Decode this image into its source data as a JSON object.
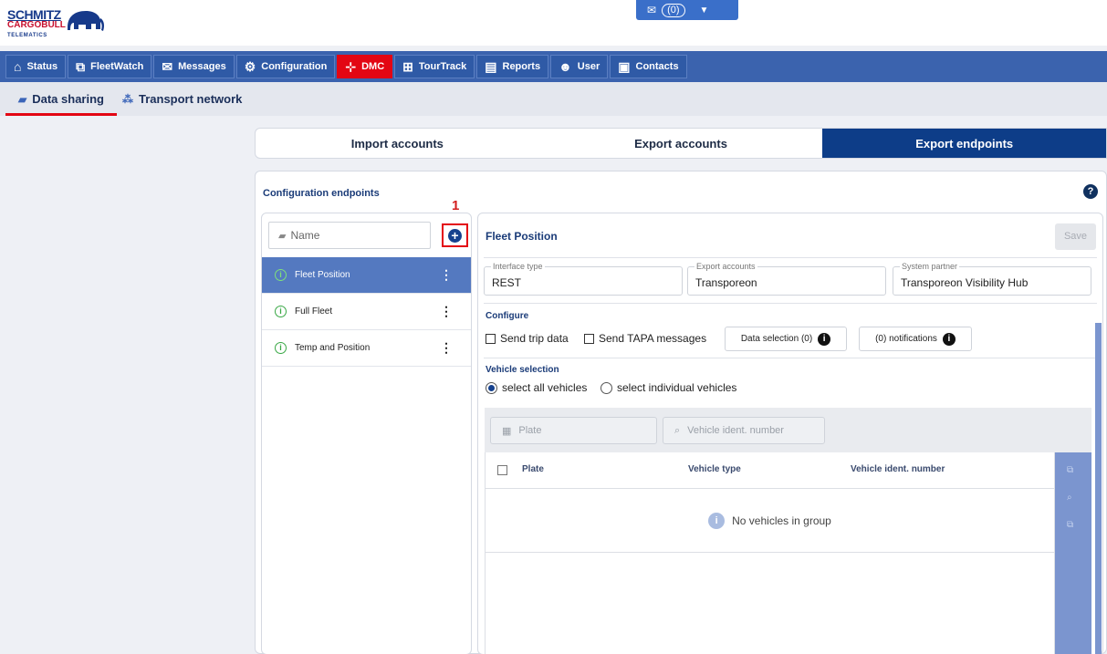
{
  "brand": {
    "line1": "SCHMITZ",
    "line2": "CARGOBULL",
    "line3": "TELEMATICS"
  },
  "messages_button": {
    "count": "0"
  },
  "main_nav": [
    {
      "label": "Status",
      "icon": "home-icon"
    },
    {
      "label": "FleetWatch",
      "icon": "fleetwatch-icon"
    },
    {
      "label": "Messages",
      "icon": "envelope-icon"
    },
    {
      "label": "Configuration",
      "icon": "gear-icon"
    },
    {
      "label": "DMC",
      "icon": "network-icon",
      "active": true
    },
    {
      "label": "TourTrack",
      "icon": "route-icon"
    },
    {
      "label": "Reports",
      "icon": "report-icon"
    },
    {
      "label": "User",
      "icon": "users-icon"
    },
    {
      "label": "Contacts",
      "icon": "contacts-icon"
    }
  ],
  "sub_nav": [
    {
      "label": "Data sharing",
      "icon": "data-sharing-icon",
      "active": true
    },
    {
      "label": "Transport network",
      "icon": "transport-network-icon"
    }
  ],
  "tabs": [
    {
      "label": "Import accounts"
    },
    {
      "label": "Export accounts"
    },
    {
      "label": "Export endpoints",
      "active": true
    }
  ],
  "panel": {
    "title": "Configuration endpoints",
    "help": "?",
    "callout": "1"
  },
  "endpoint_list": {
    "name_placeholder": "Name",
    "items": [
      {
        "label": "Fleet Position",
        "selected": true
      },
      {
        "label": "Full Fleet"
      },
      {
        "label": "Temp and Position"
      }
    ]
  },
  "detail": {
    "title": "Fleet Position",
    "save_label": "Save",
    "interface_type": {
      "label": "Interface type",
      "value": "REST"
    },
    "export_accounts": {
      "label": "Export accounts",
      "value": "Transporeon"
    },
    "system_partner": {
      "label": "System partner",
      "value": "Transporeon Visibility Hub"
    },
    "configure_title": "Configure",
    "send_trip_data": "Send trip data",
    "send_tapa": "Send TAPA messages",
    "data_selection": "Data selection (0)",
    "notifications": "(0) notifications",
    "vehicle_selection_title": "Vehicle selection",
    "radio_all": "select all vehicles",
    "radio_individual": "select individual vehicles",
    "filter_plate": "Plate",
    "filter_vin": "Vehicle ident. number",
    "table_headers": [
      "Plate",
      "Vehicle type",
      "Vehicle ident. number"
    ],
    "empty_text": "No vehicles in group"
  },
  "colors": {
    "nav_blue": "#3b63ae",
    "active_red": "#e30613",
    "active_tab": "#0d3d88",
    "selected_item": "#5479c0"
  }
}
